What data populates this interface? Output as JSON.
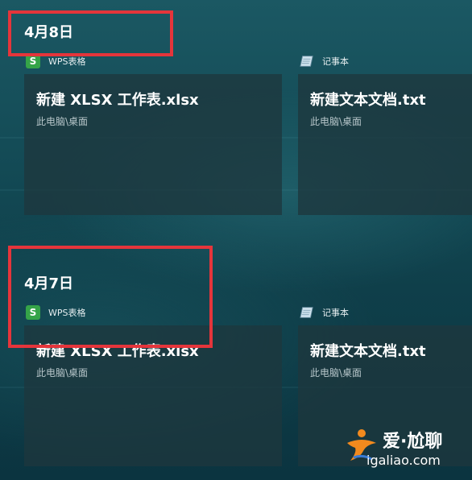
{
  "groups": [
    {
      "date": "4月8日",
      "tiles": [
        {
          "app_icon": "wps-spreadsheet-icon",
          "app_icon_glyph": "S",
          "app_name": "WPS表格",
          "title": "新建 XLSX 工作表.xlsx",
          "path": "此电脑\\桌面"
        },
        {
          "app_icon": "notepad-icon",
          "app_name": "记事本",
          "title": "新建文本文档.txt",
          "path": "此电脑\\桌面"
        }
      ]
    },
    {
      "date": "4月7日",
      "tiles": [
        {
          "app_icon": "wps-spreadsheet-icon",
          "app_icon_glyph": "S",
          "app_name": "WPS表格",
          "title": "新建 XLSX 工作表.xlsx",
          "path": "此电脑\\桌面"
        },
        {
          "app_icon": "notepad-icon",
          "app_name": "记事本",
          "title": "新建文本文档.txt",
          "path": "此电脑\\桌面"
        }
      ]
    }
  ],
  "watermark": {
    "text": "爱·尬聊",
    "url": "igaliao.com"
  },
  "colors": {
    "highlight": "#e5353b",
    "wps_green": "#35a448",
    "card_bg": "#1e373e",
    "background": "#134a55"
  }
}
